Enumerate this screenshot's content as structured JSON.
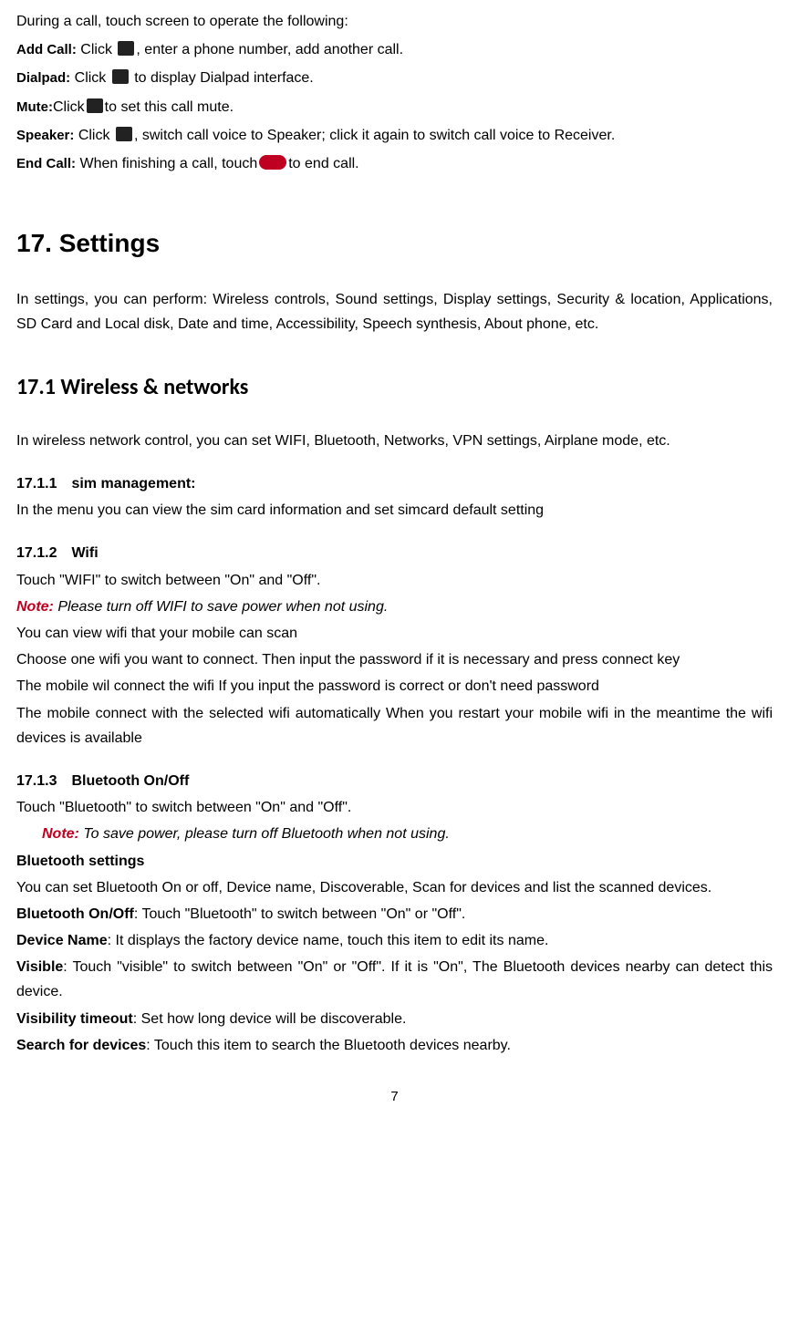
{
  "intro": "During a call, touch screen to operate the following:",
  "defs": {
    "addcall": {
      "label": "Add Call:",
      "pre": " Click ",
      "post": ", enter a phone number, add another call."
    },
    "dialpad": {
      "label": "Dialpad:",
      "pre": " Click ",
      "post": " to display Dialpad interface."
    },
    "mute": {
      "label": "Mute:",
      "pre": "Click",
      "post": "to set this call mute."
    },
    "speaker": {
      "label": "Speaker:",
      "pre": " Click ",
      "post": ", switch call voice to Speaker; click it again to switch call voice to Receiver."
    },
    "endcall": {
      "label": "End Call:",
      "pre": " When finishing a call, touch",
      "post": "to end call."
    }
  },
  "h17": "17. Settings",
  "p17": "In settings, you can perform: Wireless controls, Sound settings, Display settings, Security & location, Applications, SD Card and Local disk, Date and time, Accessibility, Speech synthesis, About phone, etc.",
  "h171": "17.1 Wireless & networks",
  "p171": "In wireless network control, you can set WIFI, Bluetooth, Networks, VPN settings, Airplane mode, etc.",
  "s1711": {
    "num": "17.1.1",
    "title": "sim management:",
    "body": "In the menu you can view the sim card information and set simcard default setting"
  },
  "s1712": {
    "num": "17.1.2",
    "title": "Wifi",
    "l1": "Touch \"WIFI\" to switch between \"On\" and \"Off\".",
    "noteLabel": "Note:",
    "noteBody": " Please turn off WIFI to save power when not using.",
    "l2": "You can view wifi that your mobile can scan",
    "l3": "Choose one wifi you want to connect. Then input the password if it is necessary and press connect key",
    "l4": "The mobile wil connect the wifi If you input the password is correct or don't need password",
    "l5": "The mobile connect with the selected wifi automatically When you restart your mobile wifi in the meantime the wifi devices is available"
  },
  "s1713": {
    "num": "17.1.3",
    "title": "Bluetooth On/Off",
    "l1": "Touch \"Bluetooth\" to switch between \"On\" and \"Off\".",
    "noteLabel": "Note:",
    "noteBody": " To save power, please turn off Bluetooth when not using.",
    "h2": "Bluetooth settings",
    "l2": "You can set Bluetooth On or off, Device name, Discoverable, Scan for devices and list the scanned devices.",
    "r1l": "Bluetooth On/Off",
    "r1b": ": Touch \"Bluetooth\" to switch between \"On\" or \"Off\".",
    "r2l": "Device Name",
    "r2b": ": It displays the factory device name, touch this item to edit its name.",
    "r3l": "Visible",
    "r3b": ": Touch \"visible\" to switch between \"On\" or \"Off\". If it is \"On\", The Bluetooth devices nearby can detect this device.",
    "r4l": "Visibility timeout",
    "r4b": ": Set how long device will be discoverable.",
    "r5l": "Search for devices",
    "r5b": ": Touch this item to search the Bluetooth devices nearby."
  },
  "pagenum": "7"
}
